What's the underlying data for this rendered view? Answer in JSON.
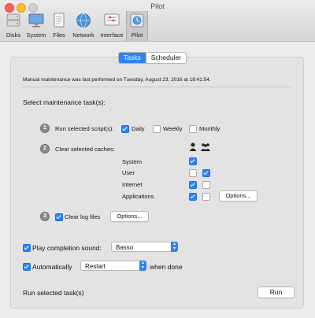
{
  "window": {
    "title": "Pilot"
  },
  "toolbar": {
    "items": [
      {
        "label": "Disks",
        "icon": "disks-icon"
      },
      {
        "label": "System",
        "icon": "monitor-icon"
      },
      {
        "label": "Files",
        "icon": "files-icon"
      },
      {
        "label": "Network",
        "icon": "globe-icon"
      },
      {
        "label": "Interface",
        "icon": "interface-icon"
      },
      {
        "label": "Pilot",
        "icon": "pilot-icon",
        "selected": true
      }
    ]
  },
  "tabs": {
    "tasks": "Tasks",
    "scheduler": "Scheduler",
    "active": "Tasks"
  },
  "maintenance_info": "Manual maintenance was last performed on Tuesday, August 23, 2016 at 18:41:54.",
  "section_title": "Select maintenance task(s):",
  "task1": {
    "number": "1",
    "label": "Run selected script(s):",
    "daily": {
      "label": "Daily",
      "checked": true
    },
    "weekly": {
      "label": "Weekly",
      "checked": false
    },
    "monthly": {
      "label": "Monthly",
      "checked": false
    }
  },
  "task2": {
    "number": "2",
    "label": "Clear selected caches:",
    "column_icons": [
      "user-icon",
      "group-icon"
    ],
    "rows": [
      {
        "label": "System",
        "user": true,
        "group": null
      },
      {
        "label": "User",
        "user": false,
        "group": true
      },
      {
        "label": "Internet",
        "user": true,
        "group": false
      },
      {
        "label": "Applications",
        "user": true,
        "group": false
      }
    ],
    "options_label": "Options..."
  },
  "task3": {
    "number": "3",
    "label": "Clear log files",
    "checked": true,
    "options_label": "Options..."
  },
  "completion_sound": {
    "label": "Play completion sound:",
    "checked": true,
    "value": "Basso"
  },
  "automatically": {
    "label": "Automatically",
    "checked": true,
    "value": "Restart",
    "suffix": "when done"
  },
  "run_label": "Run selected task(s)",
  "run_button": "Run",
  "colors": {
    "accent": "#2b83f6",
    "badge": "#8a8a8a"
  }
}
